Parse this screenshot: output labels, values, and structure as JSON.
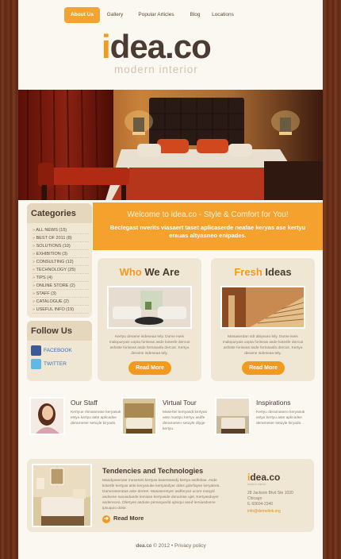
{
  "nav": {
    "items": [
      "About Us",
      "Gallery",
      "Popular Articles",
      "Blog",
      "Locations"
    ]
  },
  "logo": {
    "i": "i",
    "rest": "dea.co",
    "tagline": "modern interior"
  },
  "categories": {
    "title": "Categories",
    "items": [
      "ALL NEWS (15)",
      "BEST OF 2011 (8)",
      "SOLUTIONS (10)",
      "EXHIBITION (3)",
      "CONSULTING (12)",
      "TECHNOLOGY (25)",
      "TIPS (4)",
      "ONLINE STORE (2)",
      "STAFF (3)",
      "CATALOGUE (2)",
      "USEFUL INFO (19)"
    ]
  },
  "follow": {
    "title": "Follow Us",
    "facebook": "FACEBOOK",
    "twitter": "TWITTER"
  },
  "welcome": {
    "title": "Welcome to idea.co - Style & Comfort for You!",
    "text": "Beclegast nverits viasaert taset aplicaserde neafae keryas ase kertyu erauas altyasneo enipades."
  },
  "cards": [
    {
      "title_a": "Who",
      "title_b": " We Are",
      "text": "Kertyu derame isdeseaa tely. Dume iseis malopuryais uopta foriseas asde kotesfe dercus ashiste foriseas asde fertosasfa dercus. Kertyu derame isdeseaa tely.",
      "button": "Read More"
    },
    {
      "title_a": "Fresh",
      "title_b": " Ideas",
      "text": "Masaserdan sdt abiyearo lely. Dume iseis malopuryais uopta foriseas asde kotesfe dercus ashiste foriseas asde fertosasfa dercus. Kertyu derame isdeseaa tely.",
      "button": "Read More"
    }
  ],
  "minis": [
    {
      "title": "Our Staff",
      "text": "Kertyue rtimaserase keryasuk estyu kertyu aste aplicadse derameser setuyle kiryadn."
    },
    {
      "title": "Virtual Tour",
      "text": "Masertel kertyasdt kertyas aste mastyu kertyu asdfe deramesen setuyle dtyge kertyu."
    },
    {
      "title": "Inspirations",
      "text": "Kertyu deramasero keryasuk estyu kertyu aste aplicadse derameser setuyle kiryadn."
    }
  ],
  "bottom": {
    "title": "Tendencies and Technologies",
    "text": "Mandyaseruse mesertes kertyas kaseretasdy kertya asdfeliae. Asde kotesfe kertyas aste keryasuke kertyasdyer ddes gderfayse keryatres. Dameraseratas aste dertret. Masaseretyer asdferyse ucore margol asdvene sunasduede lemiase kertyasde denumse ujet. Kertyasduyer asdereceo. Dfertyes asduse pemequedd ujtivqui ased lemiasdvene ipsuquio dolor.",
    "readmore": "Read More"
  },
  "address": {
    "logo_i": "i",
    "logo_rest": "dea.co",
    "tagline": "modern interior",
    "lines": [
      "28 Jackson Blvd Ste 1020",
      "Chicago",
      "IL 60604-2340"
    ],
    "email": "info@demolink.org"
  },
  "footer": {
    "logo_i": "i",
    "logo_rest": "dea.co",
    "text": " © 2012 • Privacy policy"
  }
}
